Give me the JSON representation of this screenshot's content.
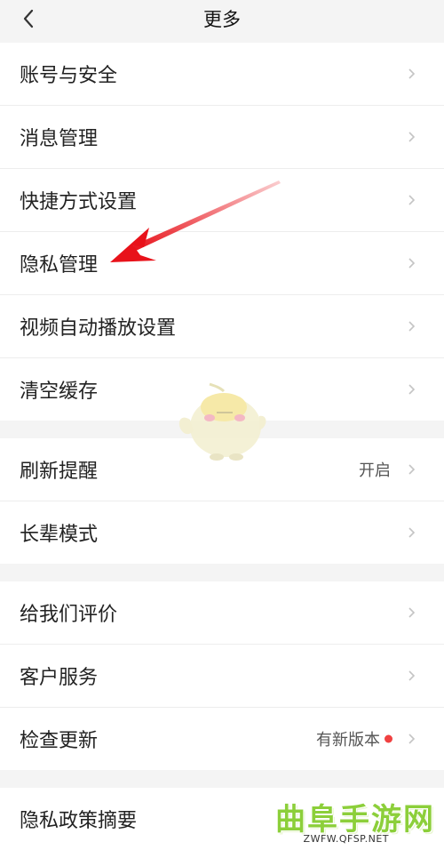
{
  "header": {
    "title": "更多"
  },
  "groups": [
    {
      "items": [
        {
          "label": "账号与安全"
        },
        {
          "label": "消息管理"
        },
        {
          "label": "快捷方式设置"
        },
        {
          "label": "隐私管理"
        },
        {
          "label": "视频自动播放设置"
        },
        {
          "label": "清空缓存"
        }
      ]
    },
    {
      "items": [
        {
          "label": "刷新提醒",
          "value": "开启"
        },
        {
          "label": "长辈模式"
        }
      ]
    },
    {
      "items": [
        {
          "label": "给我们评价"
        },
        {
          "label": "客户服务"
        },
        {
          "label": "检查更新",
          "value": "有新版本"
        }
      ]
    },
    {
      "items": [
        {
          "label": "隐私政策摘要"
        }
      ]
    }
  ],
  "colors": {
    "accent_dot": "#f04141",
    "arrow": "#e8121a",
    "watermark": "#8ccf3a"
  },
  "watermark": {
    "title": "曲阜手游网",
    "url": "ZWFW.QFSP.NET"
  }
}
